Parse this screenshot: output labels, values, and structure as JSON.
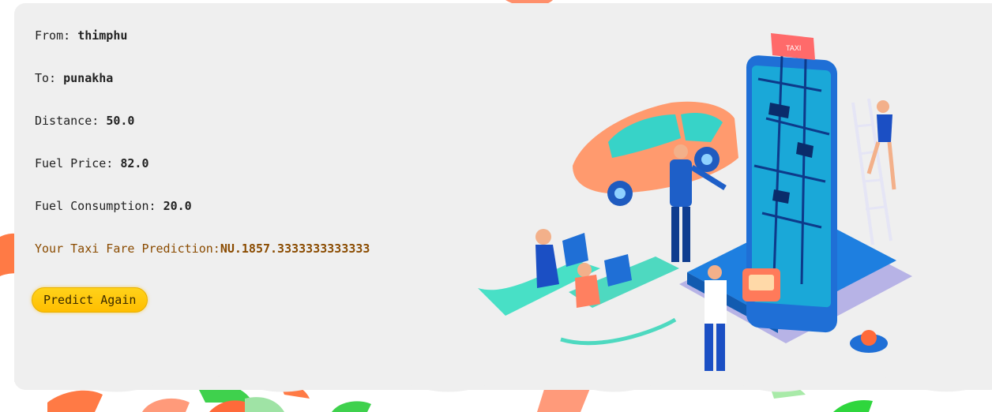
{
  "fare": {
    "from_label": "From: ",
    "from_value": "thimphu",
    "to_label": "To: ",
    "to_value": "punakha",
    "distance_label": "Distance: ",
    "distance_value": "50.0",
    "fuel_price_label": "Fuel Price: ",
    "fuel_price_value": "82.0",
    "fuel_consumption_label": "Fuel Consumption: ",
    "fuel_consumption_value": "20.0",
    "result_label": "Your Taxi Fare Prediction:",
    "result_value": "NU.1857.3333333333333"
  },
  "actions": {
    "predict_again_label": "Predict Again"
  },
  "illustration": {
    "sign_text": "TAXI"
  },
  "colors": {
    "accent": "#ffc400",
    "result_text": "#8a4b00",
    "card_bg": "#efefef"
  }
}
